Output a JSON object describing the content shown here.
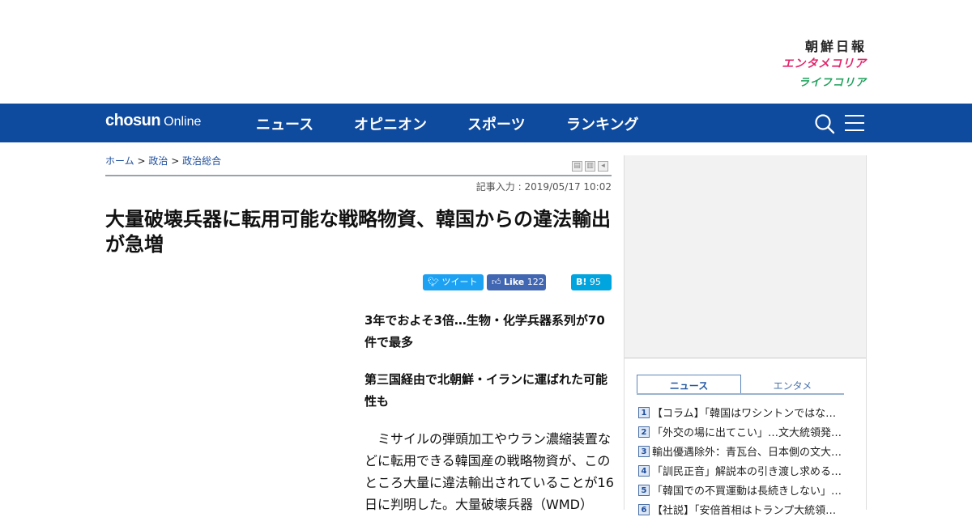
{
  "colors": {
    "nav_bg": "#0e4a9e",
    "twitter": "#1da1f2",
    "facebook": "#4267b2",
    "hatena": "#00a4de",
    "enta": "#e0266b",
    "life": "#22a15e"
  },
  "brands": {
    "chosun": "朝鮮日報",
    "enta": "エンタメコリア",
    "life": "ライフコリア"
  },
  "nav": {
    "logo_main": "chosun",
    "logo_sub": "Online",
    "items": [
      {
        "label": "ニュース"
      },
      {
        "label": "オピニオン"
      },
      {
        "label": "スポーツ"
      },
      {
        "label": "ランキング"
      }
    ],
    "search_icon": "search-icon",
    "menu_icon": "hamburger-menu-icon"
  },
  "breadcrumb": {
    "home": "ホーム",
    "sep": ">",
    "category": "政治",
    "subcategory": "政治総合"
  },
  "article": {
    "dateline": "記事入力 : 2019/05/17 10:02",
    "title": "大量破壊兵器に転用可能な戦略物資、韓国からの違法輸出が急増",
    "subheads": [
      "3年でおよそ3倍…生物・化学兵器系列が70件で最多",
      "第三国経由で北朝鮮・イランに運ばれた可能性も"
    ],
    "body": "ミサイルの弾頭加工やウラン濃縮装置などに転用できる韓国産の戦略物資が、このところ大量に違法輸出されていることが16日に判明した。大量破壊兵器（WMD）"
  },
  "share": {
    "tweet_label": "ツイート",
    "like_label": "Like",
    "like_count": "122",
    "hatena_label": "B!",
    "hatena_count": "95"
  },
  "sidebar": {
    "tabs": [
      {
        "label": "ニュース",
        "active": true
      },
      {
        "label": "エンタメ",
        "active": false
      }
    ],
    "ranking": [
      {
        "rank": "1",
        "title": "【コラム】「韓国はワシントンではな…"
      },
      {
        "rank": "2",
        "title": "「外交の場に出てこい」…文大統領発…"
      },
      {
        "rank": "3",
        "title": "輸出優遇除外：青瓦台、日本側の文大…"
      },
      {
        "rank": "4",
        "title": "「訓民正音」解説本の引き渡し求める…"
      },
      {
        "rank": "5",
        "title": "「韓国での不買運動は長続きしない」…"
      },
      {
        "rank": "6",
        "title": "【社説】「安倍首相はトランプ大統領…"
      }
    ]
  }
}
